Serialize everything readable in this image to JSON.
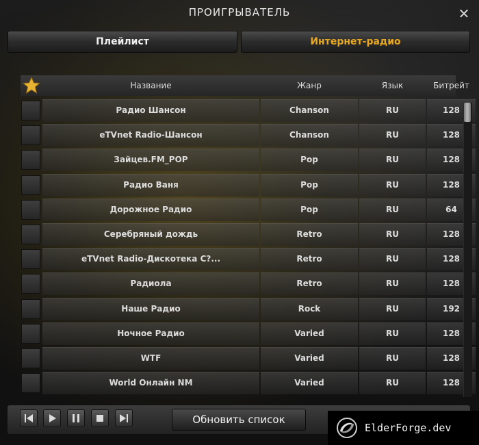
{
  "window": {
    "title": "ПРОИГРЫВАТЕЛЬ",
    "close_icon": "close-icon"
  },
  "tabs": [
    {
      "label": "Плейлист",
      "active": false
    },
    {
      "label": "Интернет-радио",
      "active": true
    }
  ],
  "accent_color": "#e8a822",
  "table": {
    "headers": {
      "name": "Название",
      "genre": "Жанр",
      "language": "Язык",
      "bitrate": "Битрейт"
    },
    "favorite_icon": "star-icon",
    "rows": [
      {
        "name": "Радио Шансон",
        "genre": "Chanson",
        "language": "RU",
        "bitrate": "128"
      },
      {
        "name": "eTVnet Radio-Шансон",
        "genre": "Chanson",
        "language": "RU",
        "bitrate": "128"
      },
      {
        "name": "Зайцев.FM_POP",
        "genre": "Pop",
        "language": "RU",
        "bitrate": "128"
      },
      {
        "name": "Радио Ваня",
        "genre": "Pop",
        "language": "RU",
        "bitrate": "128"
      },
      {
        "name": "Дорожное Радио",
        "genre": "Pop",
        "language": "RU",
        "bitrate": "64"
      },
      {
        "name": "Серебряный дождь",
        "genre": "Retro",
        "language": "RU",
        "bitrate": "128"
      },
      {
        "name": "eTVnet Radio-Дискотека С?...",
        "genre": "Retro",
        "language": "RU",
        "bitrate": "128"
      },
      {
        "name": "Радиола",
        "genre": "Retro",
        "language": "RU",
        "bitrate": "128"
      },
      {
        "name": "Наше Радио",
        "genre": "Rock",
        "language": "RU",
        "bitrate": "192"
      },
      {
        "name": "Ночное Радио",
        "genre": "Varied",
        "language": "RU",
        "bitrate": "128"
      },
      {
        "name": "WTF",
        "genre": "Varied",
        "language": "RU",
        "bitrate": "128"
      },
      {
        "name": "World Онлайн NM",
        "genre": "Varied",
        "language": "RU",
        "bitrate": "128"
      }
    ]
  },
  "controls": {
    "buttons": [
      "skip-back-icon",
      "play-icon",
      "pause-icon",
      "stop-icon",
      "skip-forward-icon"
    ],
    "refresh_label": "Обновить список"
  },
  "watermark": {
    "text": "ElderForge.dev"
  }
}
